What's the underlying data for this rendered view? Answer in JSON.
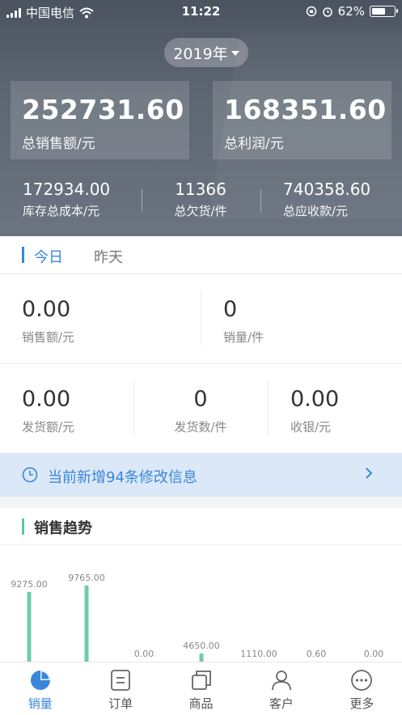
{
  "status_bar": {
    "carrier": "中国电信",
    "time": "11:22",
    "battery": "62%",
    "battery_level": 0.62
  },
  "header": {
    "year": "2019年",
    "cards": [
      {
        "value": "252731.60",
        "label": "总销售额/元"
      },
      {
        "value": "168351.60",
        "label": "总利润/元"
      }
    ],
    "stats": [
      {
        "value": "172934.00",
        "label": "库存总成本/元"
      },
      {
        "value": "11366",
        "label": "总欠货/件"
      },
      {
        "value": "740358.60",
        "label": "总应收款/元"
      }
    ]
  },
  "tabs": [
    "今日",
    "昨天"
  ],
  "today": {
    "row1": [
      {
        "value": "0.00",
        "label": "销售额/元"
      },
      {
        "value": "0",
        "label": "销量/件"
      }
    ],
    "row2": [
      {
        "value": "0.00",
        "label": "发货额/元"
      },
      {
        "value": "0",
        "label": "发货数/件"
      },
      {
        "value": "0.00",
        "label": "收银/元"
      }
    ]
  },
  "notice": {
    "text": "当前新增94条修改信息",
    "icon": "clock-icon"
  },
  "trend": {
    "title": "销售趋势"
  },
  "chart_data": {
    "type": "bar",
    "values": [
      9275.0,
      9765.0,
      0.0,
      4650.0,
      1110.0,
      0.6,
      0.0
    ],
    "value_labels": [
      "9275.00",
      "9765.00",
      "0.00",
      "4650.00",
      "1110.00",
      "0.60",
      "0.00"
    ],
    "color": "#6fcbae"
  },
  "nav": [
    {
      "label": "销量",
      "icon": "pie-chart-icon",
      "active": true
    },
    {
      "label": "订单",
      "icon": "order-icon",
      "active": false
    },
    {
      "label": "商品",
      "icon": "goods-icon",
      "active": false
    },
    {
      "label": "客户",
      "icon": "customer-icon",
      "active": false
    },
    {
      "label": "更多",
      "icon": "more-icon",
      "active": false
    }
  ],
  "colors": {
    "accent": "#3a86d8",
    "trend": "#5cc6a6",
    "notice_bg": "#dbe8f8"
  }
}
